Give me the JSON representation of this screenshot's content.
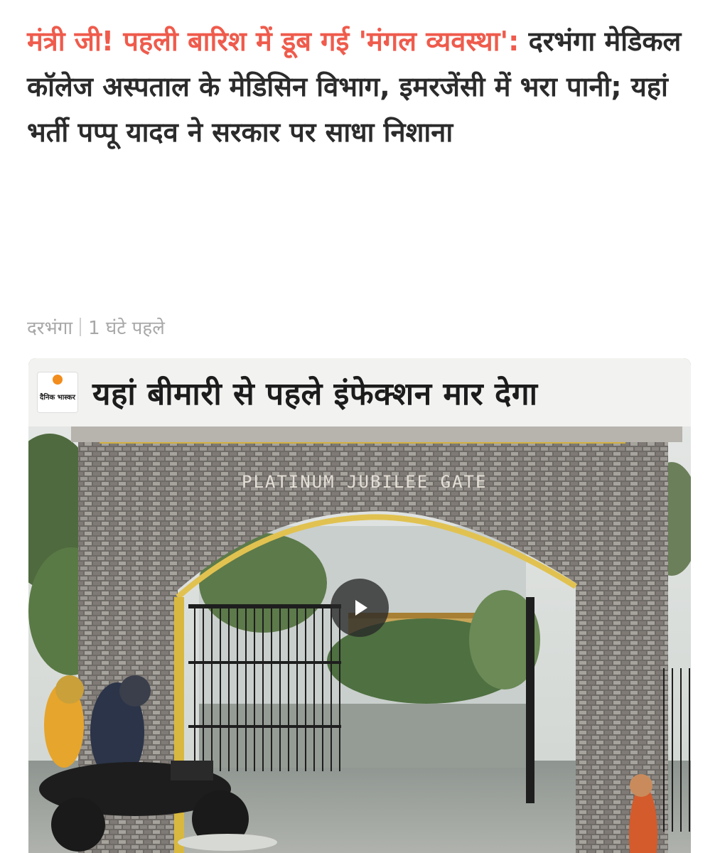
{
  "headline": {
    "accent": "मंत्री जी! पहली बारिश में डूब गई 'मंगल व्यवस्था':",
    "rest": " दरभंगा मेडिकल कॉलेज अस्पताल के मेडिसिन विभाग, इमरजेंसी में भरा पानी; यहां भर्ती पप्पू यादव ने सरकार पर साधा निशाना"
  },
  "meta": {
    "location": "दरभंगा",
    "time": "1 घंटे पहले"
  },
  "media": {
    "banner_text": "यहां बीमारी से पहले इंफेक्शन मार देगा",
    "logo_text": "दैनिक भास्कर",
    "gate_sign": "PLATINUM JUBILEE GATE",
    "play_icon": "play-icon"
  },
  "colors": {
    "accent": "#ef5b4c",
    "headline_text": "#2b2b2b",
    "meta_text": "#a8a8a8",
    "logo_orange": "#f28c1c"
  }
}
